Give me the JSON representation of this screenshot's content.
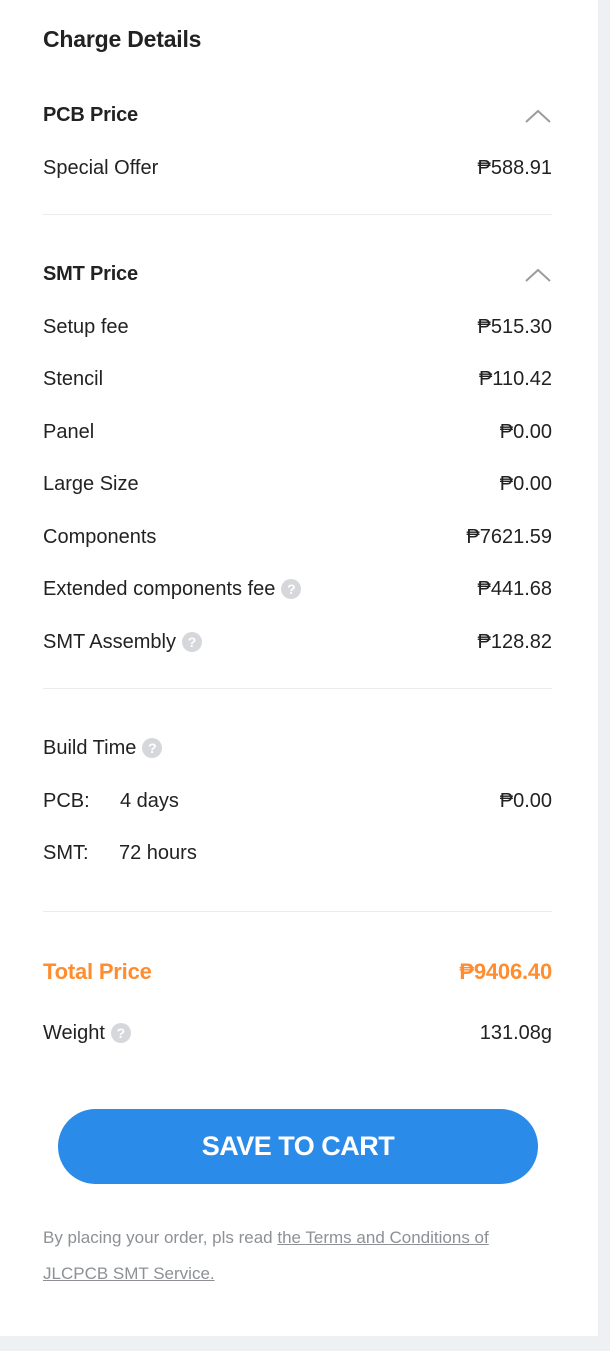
{
  "title": "Charge Details",
  "pcb_section": {
    "title": "PCB Price",
    "collapse_icon": "chevron-up-icon",
    "special_offer_label": "Special Offer",
    "special_offer_value": "₱588.91"
  },
  "smt_section": {
    "title": "SMT Price",
    "collapse_icon": "chevron-up-icon",
    "items": [
      {
        "label": "Setup fee",
        "value": "₱515.30"
      },
      {
        "label": "Stencil",
        "value": "₱110.42"
      },
      {
        "label": "Panel",
        "value": "₱0.00"
      },
      {
        "label": "Large Size",
        "value": "₱0.00"
      },
      {
        "label": "Components",
        "value": "₱7621.59"
      },
      {
        "label": "Extended components fee",
        "value": "₱441.68",
        "help_icon": "question-circle-icon"
      },
      {
        "label": "SMT Assembly",
        "value": "₱128.82",
        "help_icon": "question-circle-icon"
      }
    ]
  },
  "build_time": {
    "label": "Build Time",
    "help_icon": "question-circle-icon",
    "pcb_label": "PCB:",
    "pcb_time": "4 days",
    "pcb_value": "₱0.00",
    "smt_label": "SMT:",
    "smt_time": "72 hours"
  },
  "total": {
    "label": "Total Price",
    "value": "₱9406.40"
  },
  "weight": {
    "label": "Weight",
    "help_icon": "question-circle-icon",
    "value": "131.08g"
  },
  "cart_button_label": "SAVE TO CART",
  "notice": {
    "prefix": "By placing your order, pls read ",
    "link_text": "the Terms and Conditions of JLCPCB SMT Service."
  },
  "colors": {
    "accent_blue": "#2b8be8",
    "total_orange": "#ff8d2f",
    "help_icon_gray": "#d5d7da"
  }
}
